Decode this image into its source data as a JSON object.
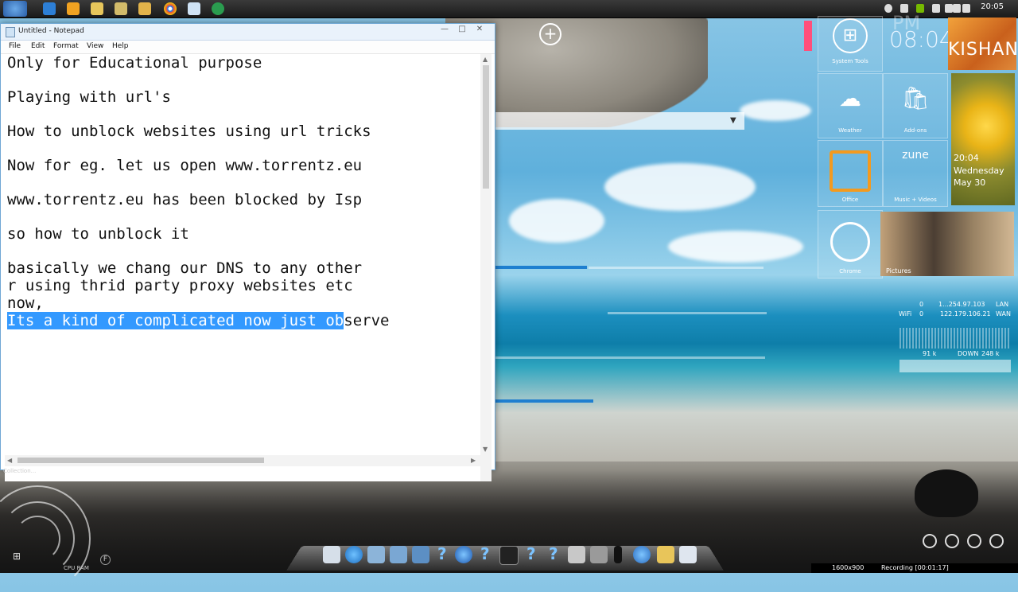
{
  "taskbar": {
    "clock": "20:05"
  },
  "notepad": {
    "title": "Untitled - Notepad",
    "window_buttons": [
      "—",
      "□",
      "✕"
    ],
    "menu": [
      "File",
      "Edit",
      "Format",
      "View",
      "Help"
    ],
    "lines": [
      "Only for Educational purpose",
      "Playing with url's",
      "How to unblock websites using url tricks",
      "Now for eg. let us open www.torrentz.eu",
      "www.torrentz.eu has been blocked by Isp",
      "so how to unblock it",
      "basically we chang our DNS to any other",
      "r using thrid party proxy websites etc",
      "now,"
    ],
    "last_line_selected": "Its a kind of complicated now just ob",
    "last_line_rest": "serve"
  },
  "tiles": {
    "system_tools": "System Tools",
    "weather": "Weather",
    "addons": "Add-ons",
    "office": "Office",
    "zune": "zune",
    "music_videos": "Music + Videos",
    "chrome": "Chrome",
    "pictures": "Pictures",
    "pm": "PM",
    "clock": "08:04",
    "kishan": "KISHAN",
    "flower_time": "20:04",
    "flower_day": "Wednesday",
    "flower_date": "May 30"
  },
  "network": {
    "lan_left": "0",
    "lan_ip": "1...254.97.103",
    "lan_label": "LAN",
    "wifi_label": "WiFi",
    "wifi_val": "0",
    "wan_ip": "122.179.106.21",
    "wan_label": "WAN",
    "up": "91 k",
    "down_label": "DOWN",
    "down": "248 k"
  },
  "gadget": {
    "label": "CPU RAM",
    "f": "F",
    "collection": "Collection..."
  },
  "status": {
    "resolution": "1600x900",
    "recording": "Recording [00:01:17]"
  }
}
